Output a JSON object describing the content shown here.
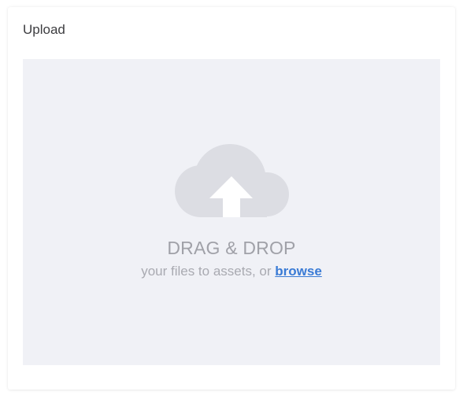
{
  "card": {
    "title": "Upload"
  },
  "dropzone": {
    "title": "DRAG & DROP",
    "subtitle": "your files to assets, or",
    "browse_label": "browse",
    "icon": "cloud-upload-icon"
  },
  "colors": {
    "dropzone_bg": "#f0f1f6",
    "icon": "#dcdde3",
    "muted_text": "#a0a1a8",
    "link": "#3a7bd5"
  }
}
